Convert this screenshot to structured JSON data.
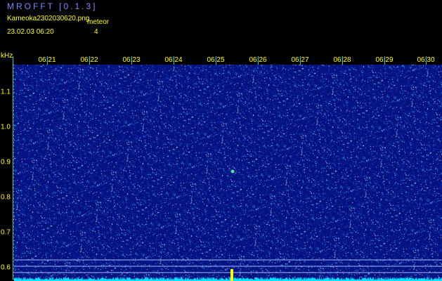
{
  "header": {
    "app_title": "MROFFT [0.1.3]",
    "filename": "Kameoka2302030620.png",
    "datetime": "23.02.03 06:20",
    "meteor_label": "meteor",
    "meteor_count": "4"
  },
  "axes": {
    "frequency_unit": "kHz",
    "time_ticks": [
      "06:21",
      "06:22",
      "06:23",
      "06:24",
      "06:25",
      "06:26",
      "06:27",
      "06:28",
      "06:29",
      "06:30"
    ],
    "frequency_ticks": [
      "1.1",
      "1.0",
      "0.9",
      "0.8",
      "0.7",
      "0.6"
    ]
  },
  "colors": {
    "background": "#000000",
    "noise_base": "#0a1a8a",
    "axis": "#27c7d6",
    "text": "#ffff00",
    "title": "#7f86ff",
    "baseline": "#00e5ff",
    "guide_line": "#9fb8ff",
    "meteor_echo": "#ffff00"
  }
}
